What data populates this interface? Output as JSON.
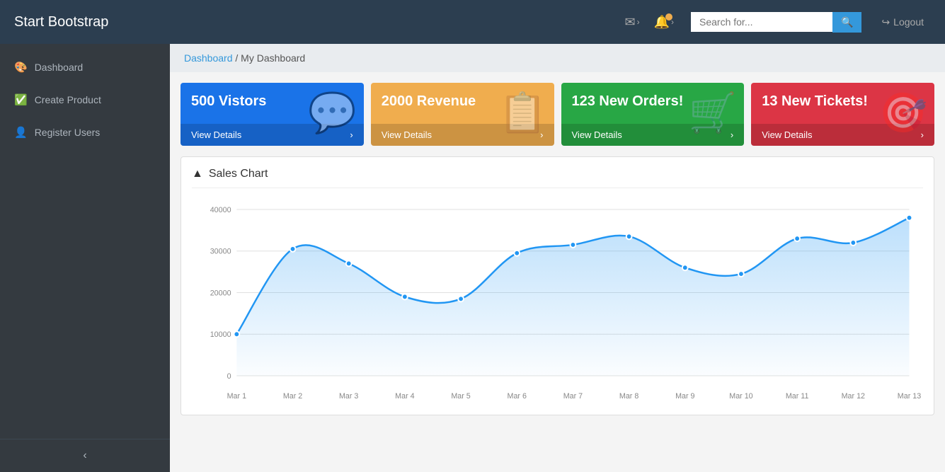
{
  "brand": "Start Bootstrap",
  "navbar": {
    "search_placeholder": "Search for...",
    "logout_label": "Logout",
    "mail_icon": "✉",
    "bell_icon": "🔔",
    "chevron": "›"
  },
  "sidebar": {
    "items": [
      {
        "id": "dashboard",
        "label": "Dashboard",
        "icon": "🎨"
      },
      {
        "id": "create-product",
        "label": "Create Product",
        "icon": "✅"
      },
      {
        "id": "register-users",
        "label": "Register Users",
        "icon": "👤"
      }
    ],
    "toggle_icon": "‹"
  },
  "breadcrumb": {
    "link_label": "Dashboard",
    "separator": "/",
    "current": "My Dashboard"
  },
  "cards": [
    {
      "id": "visitors",
      "title": "500 Vistors",
      "footer": "View Details",
      "icon": "💬",
      "color_class": "card-blue"
    },
    {
      "id": "revenue",
      "title": "2000 Revenue",
      "footer": "View Details",
      "icon": "📊",
      "color_class": "card-yellow"
    },
    {
      "id": "orders",
      "title": "123 New Orders!",
      "footer": "View Details",
      "icon": "🛒",
      "color_class": "card-green"
    },
    {
      "id": "tickets",
      "title": "13 New Tickets!",
      "footer": "View Details",
      "icon": "🎯",
      "color_class": "card-red"
    }
  ],
  "chart": {
    "title": "Sales Chart",
    "title_icon": "📈",
    "labels": [
      "Mar 1",
      "Mar 2",
      "Mar 3",
      "Mar 4",
      "Mar 5",
      "Mar 6",
      "Mar 7",
      "Mar 8",
      "Mar 9",
      "Mar 10",
      "Mar 11",
      "Mar 12",
      "Mar 13"
    ],
    "values": [
      10000,
      30500,
      27000,
      19000,
      18500,
      29500,
      31500,
      33500,
      26000,
      24500,
      33000,
      32000,
      38000
    ],
    "y_labels": [
      "0",
      "10000",
      "20000",
      "30000",
      "40000"
    ],
    "accent_color": "#2196F3",
    "fill_color": "rgba(33,150,243,0.15)"
  }
}
